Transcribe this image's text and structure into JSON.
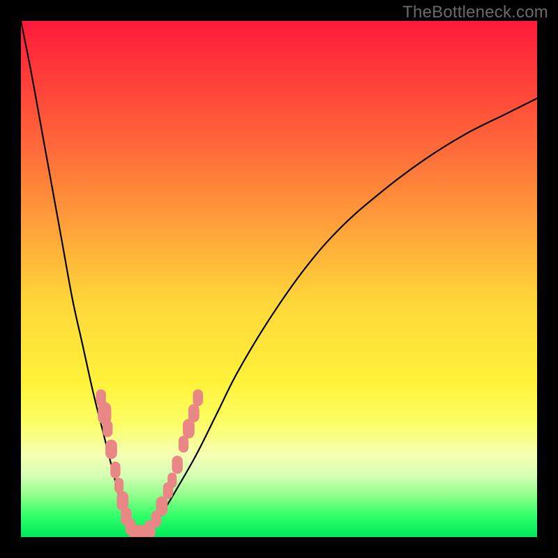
{
  "watermark": "TheBottleneck.com",
  "colors": {
    "curve_stroke": "#000000",
    "marker_fill": "#e98787",
    "marker_stroke": "#e98787"
  },
  "chart_data": {
    "type": "line",
    "title": "",
    "xlabel": "",
    "ylabel": "",
    "xlim": [
      0,
      100
    ],
    "ylim": [
      0,
      100
    ],
    "grid": false,
    "series": [
      {
        "name": "bottleneck-curve",
        "x": [
          0,
          2,
          4,
          6,
          8,
          10,
          12,
          14,
          16,
          18,
          19,
          20,
          21,
          22,
          23,
          25,
          27,
          30,
          34,
          38,
          42,
          48,
          55,
          62,
          70,
          78,
          86,
          94,
          100
        ],
        "y": [
          100,
          90,
          79,
          68,
          57,
          46,
          37,
          28,
          20,
          12,
          8,
          4,
          1,
          0,
          0,
          1,
          4,
          9,
          16,
          24,
          32,
          42,
          52,
          60,
          67,
          73,
          78,
          82,
          85
        ]
      }
    ],
    "markers": [
      {
        "x": 15.5,
        "y": 27,
        "size": 1.2
      },
      {
        "x": 16.2,
        "y": 24,
        "size": 1.6
      },
      {
        "x": 16.8,
        "y": 21,
        "size": 1.2
      },
      {
        "x": 17.5,
        "y": 17,
        "size": 1.4
      },
      {
        "x": 18.3,
        "y": 13,
        "size": 1.2
      },
      {
        "x": 19.0,
        "y": 10,
        "size": 1.1
      },
      {
        "x": 19.7,
        "y": 7,
        "size": 1.4
      },
      {
        "x": 20.4,
        "y": 4,
        "size": 1.3
      },
      {
        "x": 21.2,
        "y": 2,
        "size": 1.2
      },
      {
        "x": 22.0,
        "y": 0.8,
        "size": 1.3
      },
      {
        "x": 23.0,
        "y": 0.6,
        "size": 1.3
      },
      {
        "x": 24.0,
        "y": 0.8,
        "size": 1.2
      },
      {
        "x": 25.0,
        "y": 1.5,
        "size": 1.3
      },
      {
        "x": 26.2,
        "y": 3.5,
        "size": 1.2
      },
      {
        "x": 27.3,
        "y": 6,
        "size": 1.4
      },
      {
        "x": 28.5,
        "y": 9,
        "size": 1.2
      },
      {
        "x": 29.3,
        "y": 11,
        "size": 1.1
      },
      {
        "x": 30.3,
        "y": 14,
        "size": 1.3
      },
      {
        "x": 31.5,
        "y": 18,
        "size": 1.2
      },
      {
        "x": 32.5,
        "y": 21,
        "size": 1.4
      },
      {
        "x": 33.5,
        "y": 24,
        "size": 1.3
      },
      {
        "x": 34.3,
        "y": 27,
        "size": 1.2
      }
    ]
  }
}
